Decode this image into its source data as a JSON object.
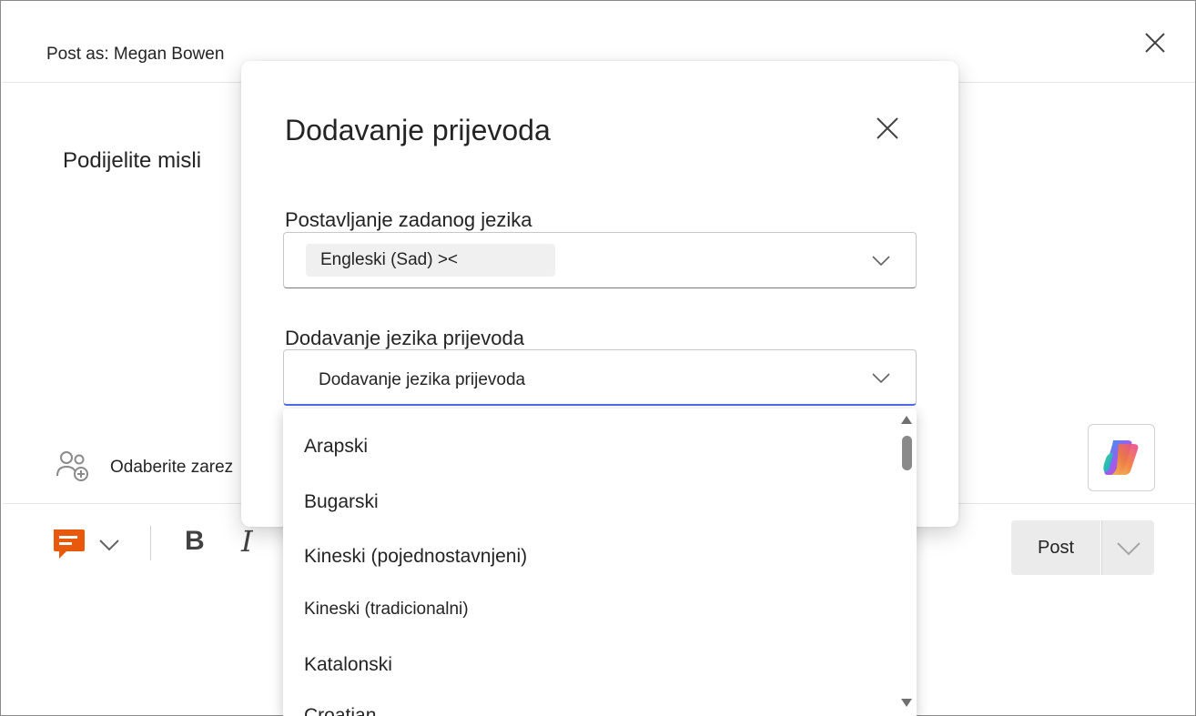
{
  "composer": {
    "post_as": "Post as: Megan Bowen",
    "placeholder": "Podijelite misli",
    "audience": "Odaberite zarez",
    "post_label": "Post"
  },
  "dialog": {
    "title": "Dodavanje prijevoda",
    "default_language_label": "Postavljanje zadanog jezika",
    "default_language_value": "Engleski (Sad) ><",
    "translation_language_label": "Dodavanje jezika prijevoda",
    "translation_language_placeholder": "Dodavanje jezika prijevoda"
  },
  "language_options": [
    "Arapski",
    "Bugarski",
    "Kineski (pojednostavnjeni)",
    "Kineski (tradicionalni)",
    "Katalonski",
    "Croatian"
  ],
  "colors": {
    "accent": "#4f6bed",
    "praise": "#e8590c"
  }
}
